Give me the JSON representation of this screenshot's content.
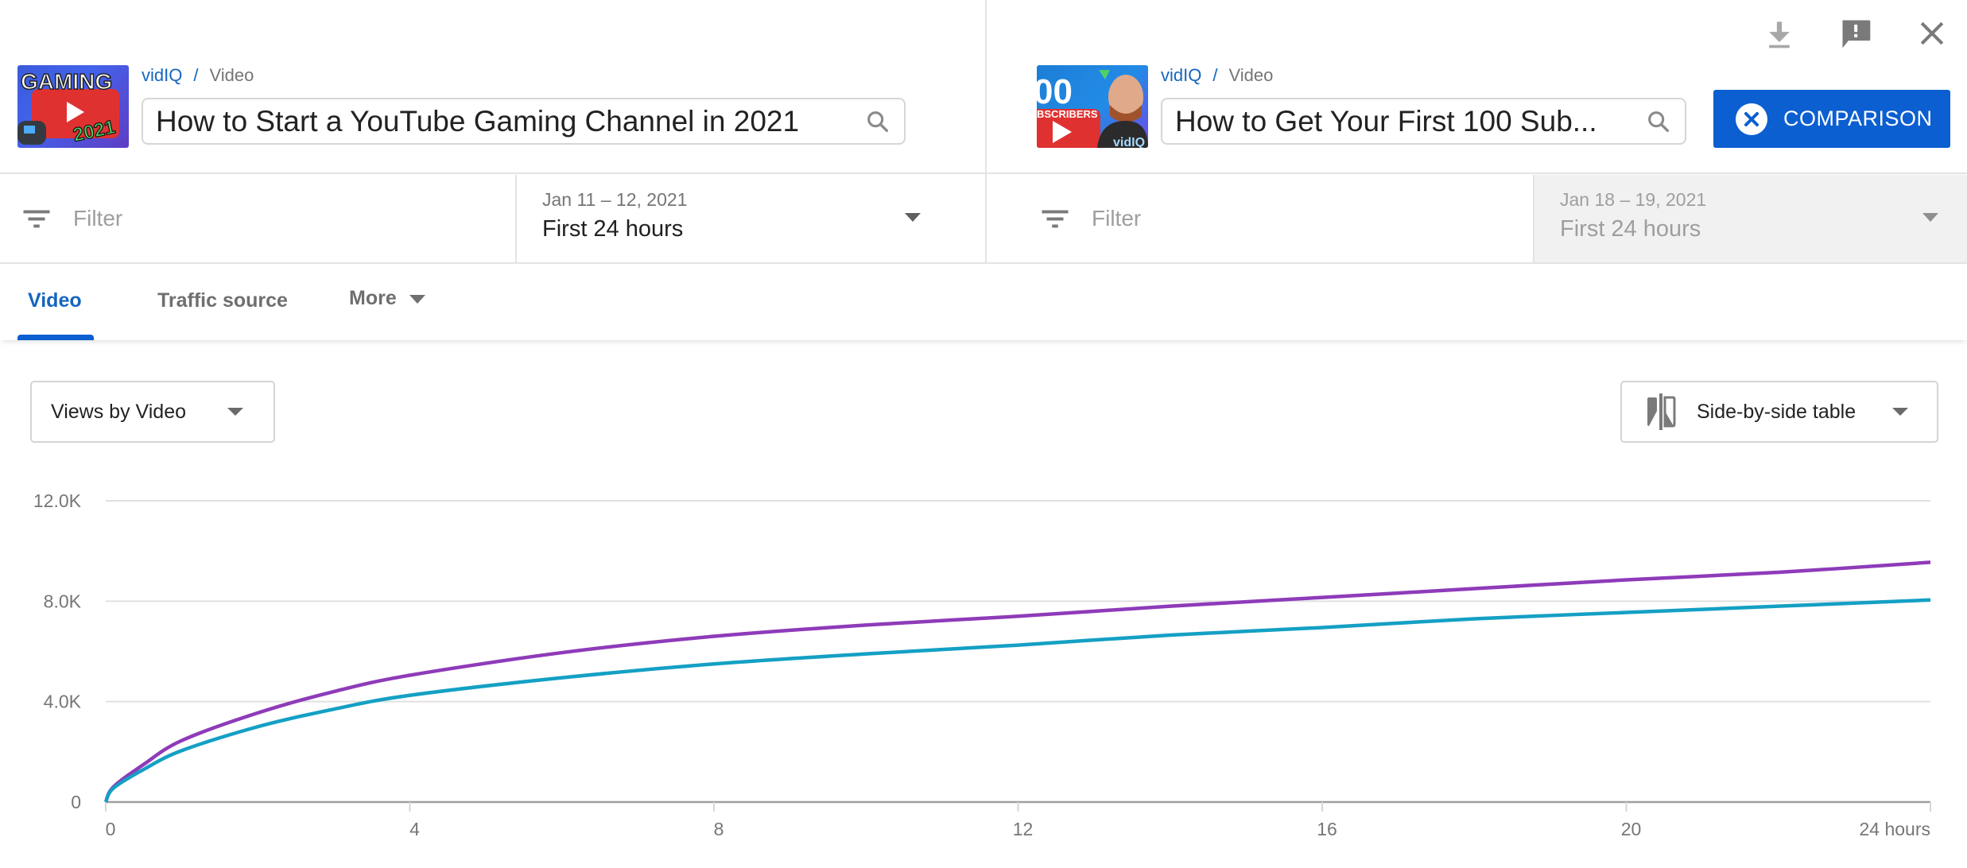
{
  "header": {
    "actions": [
      {
        "name": "download-icon",
        "label": "Download"
      },
      {
        "name": "feedback-icon",
        "label": "Send feedback"
      },
      {
        "name": "close-icon",
        "label": "Close"
      }
    ]
  },
  "left": {
    "breadcrumb": {
      "channel": "vidIQ",
      "separator": "/",
      "section": "Video"
    },
    "search_value": "How to Start a YouTube Gaming Channel in 2021",
    "thumbnail_text": [
      "GAMING",
      "2021"
    ],
    "filter_placeholder": "Filter",
    "date_range": "Jan 11 – 12, 2021",
    "period": "First 24 hours"
  },
  "right": {
    "breadcrumb": {
      "channel": "vidIQ",
      "separator": "/",
      "section": "Video"
    },
    "search_value": "How to Get Your First 100 Sub...",
    "thumbnail_text": [
      "00",
      "BSCRIBERS"
    ],
    "filter_placeholder": "Filter",
    "date_range": "Jan 18 – 19, 2021",
    "period": "First 24 hours"
  },
  "comparison_button": {
    "label": "COMPARISON",
    "icon": "close-circle-icon",
    "color": "#0b5fd0"
  },
  "tabs": [
    {
      "label": "Video",
      "active": true
    },
    {
      "label": "Traffic source",
      "active": false
    },
    {
      "label": "More",
      "active": false,
      "has_dropdown": true
    }
  ],
  "controls": {
    "metric_dropdown": "Views by Video",
    "view_dropdown": "Side-by-side table",
    "view_icon": "compare-icon"
  },
  "chart_data": {
    "type": "line",
    "title": "",
    "xlabel": "",
    "ylabel": "Views",
    "x_ticks": [
      "0",
      "4",
      "8",
      "12",
      "16",
      "20",
      "24 hours"
    ],
    "x_tick_values": [
      0,
      4,
      8,
      12,
      16,
      20,
      24
    ],
    "y_ticks": [
      "0",
      "4.0K",
      "8.0K",
      "12.0K"
    ],
    "y_tick_values": [
      0,
      4000,
      8000,
      12000
    ],
    "xlim": [
      0,
      24
    ],
    "ylim": [
      0,
      12000
    ],
    "grid": true,
    "legend": "none",
    "x": [
      0,
      0.1,
      0.5,
      1,
      2,
      3,
      4,
      6,
      8,
      10,
      12,
      14,
      16,
      18,
      20,
      22,
      24
    ],
    "series": [
      {
        "name": "How to Start a YouTube Gaming Channel in 2021",
        "color": "#8e3bb9",
        "values": [
          0,
          600,
          1500,
          2450,
          3550,
          4400,
          5050,
          5950,
          6600,
          7050,
          7400,
          7800,
          8150,
          8500,
          8850,
          9150,
          9550
        ]
      },
      {
        "name": "How to Get Your First 100 Sub...",
        "color": "#14a0c4",
        "values": [
          0,
          550,
          1300,
          2050,
          3000,
          3700,
          4250,
          4950,
          5500,
          5900,
          6250,
          6650,
          6950,
          7300,
          7550,
          7800,
          8050
        ]
      }
    ]
  }
}
